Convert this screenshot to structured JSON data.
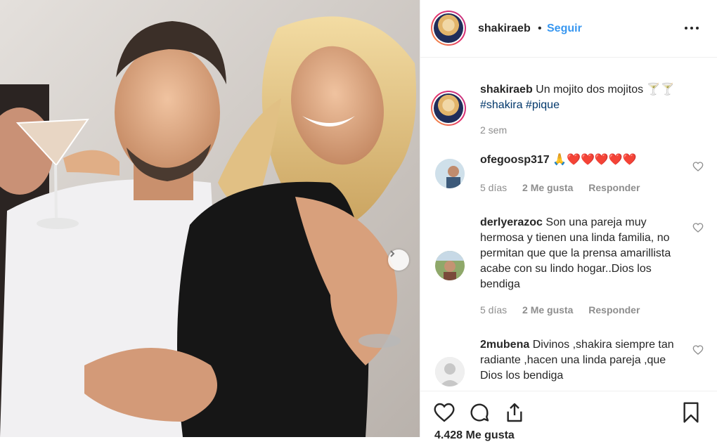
{
  "post": {
    "username": "shakiraeb",
    "separator": "•",
    "follow_label": "Seguir",
    "caption_text": "Un mojito dos mojitos 🍸🍸",
    "hashtags": "#shakira #pique",
    "time": "2 sem",
    "likes": "4.428 Me gusta"
  },
  "comments": [
    {
      "username": "ofegoosp317",
      "text": "🙏❤️❤️❤️❤️❤️",
      "time": "5 días",
      "likes": "2 Me gusta",
      "reply": "Responder"
    },
    {
      "username": "derlyerazoc",
      "text": "Son una pareja muy hermosa y tienen una linda familia, no permitan que que la prensa amarillista acabe con su lindo hogar..Dios los bendiga",
      "time": "5 días",
      "likes": "2 Me gusta",
      "reply": "Responder"
    },
    {
      "username": "2mubena",
      "text": "Divinos ,shakira siempre tan radiante ,hacen una linda pareja ,que Dios los bendiga"
    }
  ],
  "icons": {
    "more": "more-options-icon",
    "like": "heart-icon",
    "comment": "comment-icon",
    "share": "share-icon",
    "save": "bookmark-icon",
    "next": "chevron-right-icon"
  },
  "colors": {
    "link": "#3897f0",
    "hashtag": "#00376b",
    "muted": "#8e8e8e",
    "text": "#262626"
  }
}
